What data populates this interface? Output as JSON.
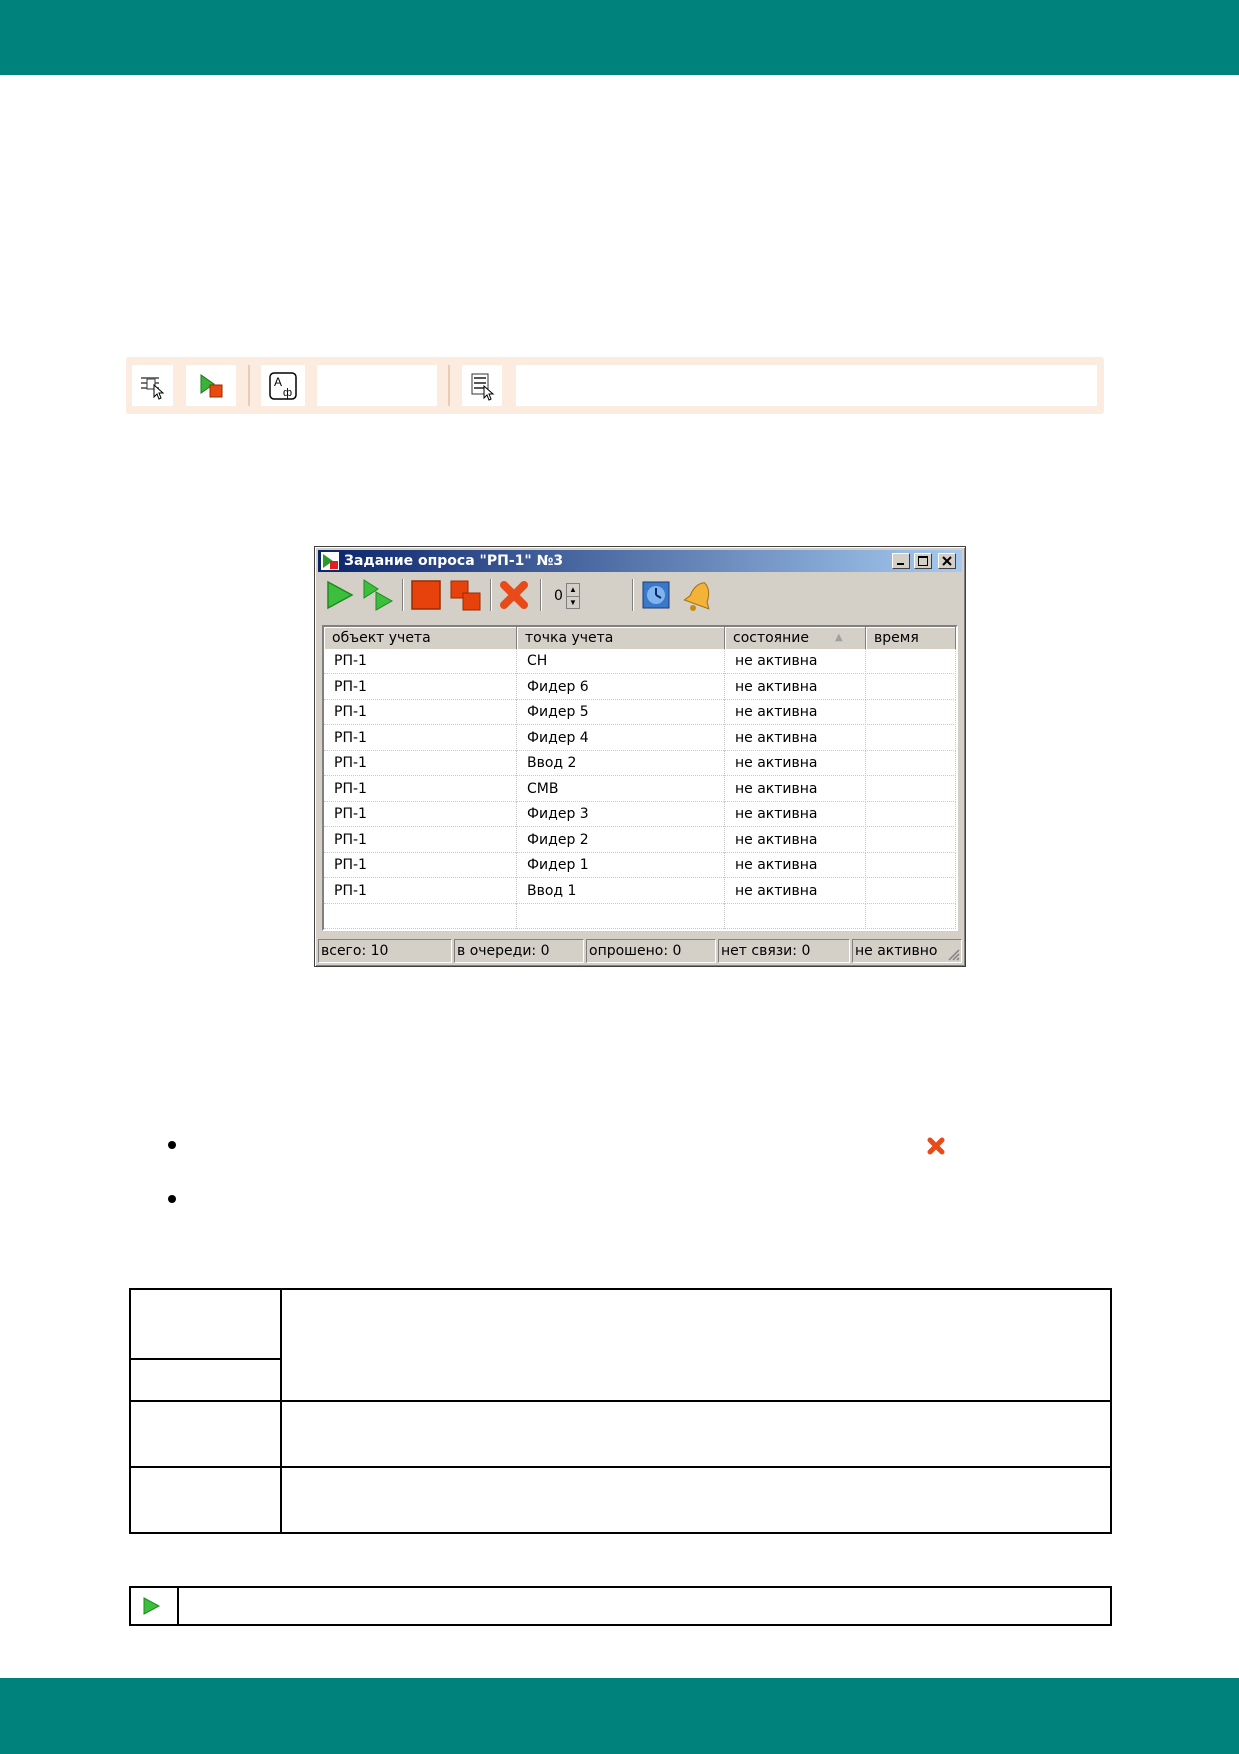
{
  "window": {
    "title": "Задание опроса \"РП-1\" №3",
    "spin_value": "0",
    "columns": [
      "объект учета",
      "точка учета",
      "состояние",
      "время"
    ],
    "rows": [
      [
        "РП-1",
        "СН",
        "не активна",
        ""
      ],
      [
        "РП-1",
        "Фидер 6",
        "не активна",
        ""
      ],
      [
        "РП-1",
        "Фидер 5",
        "не активна",
        ""
      ],
      [
        "РП-1",
        "Фидер 4",
        "не активна",
        ""
      ],
      [
        "РП-1",
        "Ввод 2",
        "не активна",
        ""
      ],
      [
        "РП-1",
        "СМВ",
        "не активна",
        ""
      ],
      [
        "РП-1",
        "Фидер 3",
        "не активна",
        ""
      ],
      [
        "РП-1",
        "Фидер 2",
        "не активна",
        ""
      ],
      [
        "РП-1",
        "Фидер 1",
        "не активна",
        ""
      ],
      [
        "РП-1",
        "Ввод 1",
        "не активна",
        ""
      ]
    ],
    "status": [
      "всего: 10",
      "в очереди: 0",
      "опрошено: 0",
      "нет связи: 0",
      "не активно"
    ]
  },
  "icons": {
    "strip": [
      "select-tool-icon",
      "play-stop-icon",
      "font-icon",
      "report-select-icon"
    ],
    "toolbar": [
      "play-icon",
      "play-next-icon",
      "stop-icon",
      "stop-all-icon",
      "delete-icon",
      "clock-icon",
      "bell-icon"
    ]
  },
  "colors": {
    "band": "#00827c",
    "strip": "#fcebdf",
    "titlebar_start": "#0a246a",
    "titlebar_end": "#a6caf0"
  }
}
